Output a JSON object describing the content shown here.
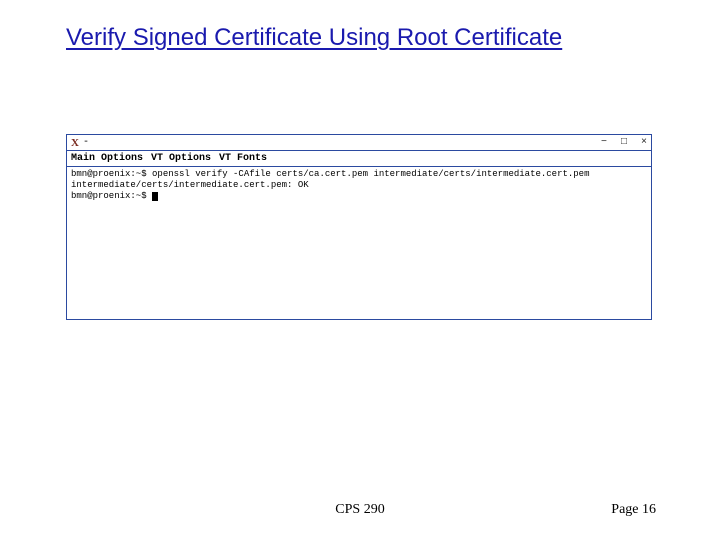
{
  "title": "Verify Signed Certificate Using Root Certificate",
  "terminal": {
    "title_icon_label": "X",
    "title_center": "-",
    "win_minimize": "−",
    "win_maximize": "□",
    "win_close": "×",
    "menu": {
      "main": "Main Options",
      "vt_options": "VT Options",
      "vt_fonts": "VT Fonts"
    },
    "lines": [
      "bmn@proenix:~$ openssl verify -CAfile certs/ca.cert.pem intermediate/certs/intermediate.cert.pem",
      "intermediate/certs/intermediate.cert.pem: OK",
      "bmn@proenix:~$ "
    ]
  },
  "footer": {
    "course": "CPS 290",
    "page": "Page 16"
  }
}
